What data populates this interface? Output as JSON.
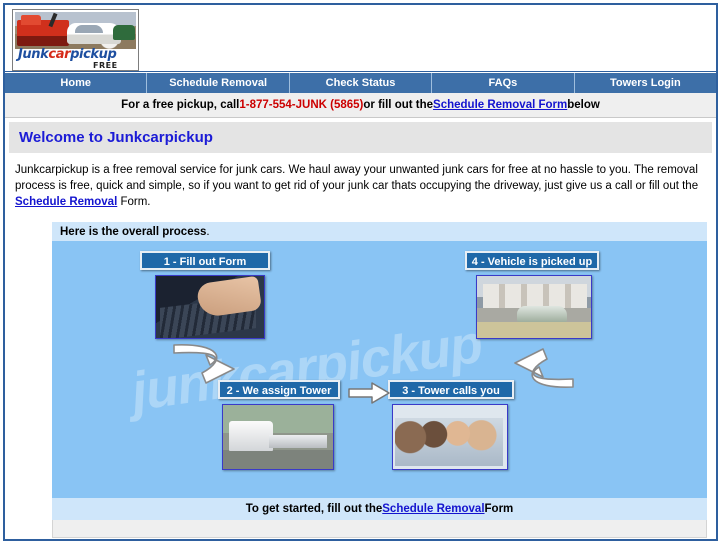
{
  "site": {
    "logo": {
      "word_part1": "Junk",
      "word_part2": "car",
      "word_part3": "pickup",
      "tagline": "FREE",
      "photo_alt": "tow-truck-loading-junk-car"
    }
  },
  "nav": {
    "items": [
      {
        "label": "Home"
      },
      {
        "label": "Schedule Removal"
      },
      {
        "label": "Check Status"
      },
      {
        "label": "FAQs"
      },
      {
        "label": "Towers Login"
      }
    ]
  },
  "callbar": {
    "prefix": "For a free pickup, call ",
    "phone": "1-877-554-JUNK (5865)",
    "middle": " or fill out the ",
    "link": "Schedule Removal Form",
    "suffix": " below",
    "phone_color": "#cc0000",
    "link_color": "#1414cf"
  },
  "welcome": {
    "heading": "Welcome to Junkcarpickup",
    "heading_color": "#1b1bd6",
    "paragraph_part1": "Junkcarpickup is a free removal service for junk cars. We haul away your unwanted junk cars for free at no hassle to you. The removal process is free, quick and simple, so if you want to get rid of your junk car thats occupying the driveway, just give us a call or fill out the ",
    "paragraph_link": "Schedule Removal",
    "paragraph_part2": " Form."
  },
  "process": {
    "header_bold": "Here is the overall process",
    "header_tail": ".",
    "watermark": "junkcarpickup",
    "panel_color": "#89c4f4",
    "header_color": "#cfe6fa",
    "step_box_color": "#1f68a8",
    "steps": [
      {
        "label": "1 - Fill out Form",
        "photo": "hands-typing-on-keyboard-photo"
      },
      {
        "label": "2 - We assign Tower",
        "photo": "white-flatbed-tow-truck-photo"
      },
      {
        "label": "3 - Tower calls you",
        "photo": "call-center-agents-with-headsets-photo"
      },
      {
        "label": "4 - Vehicle is picked up",
        "photo": "car-in-driveway-photo"
      }
    ],
    "footer_prefix": "To get started, fill out the ",
    "footer_link": "Schedule Removal",
    "footer_suffix": " Form"
  }
}
